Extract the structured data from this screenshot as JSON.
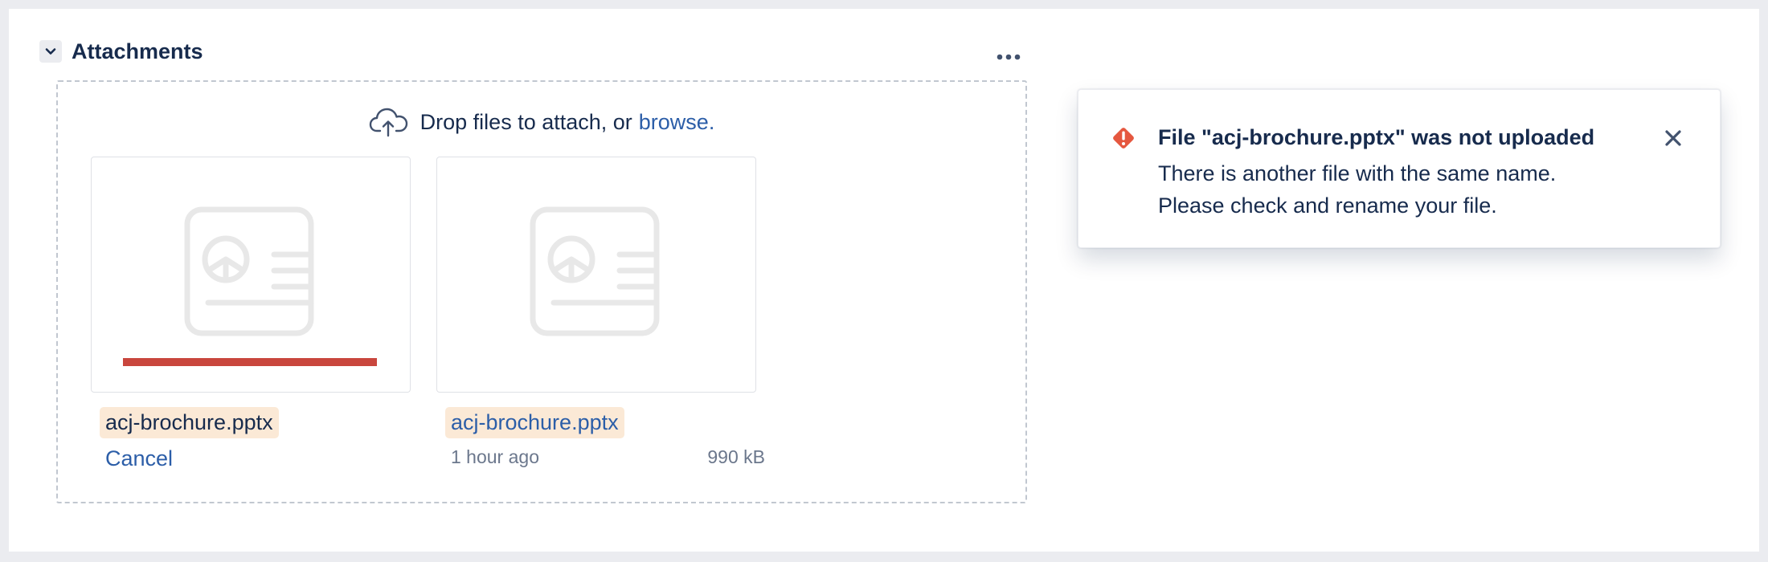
{
  "section": {
    "title": "Attachments",
    "collapse_icon": "chevron-down-icon",
    "more_icon": "more-horizontal-icon"
  },
  "dropzone": {
    "text": "Drop files to attach, or",
    "browse_label": "browse.",
    "icon": "cloud-upload-icon"
  },
  "files": [
    {
      "name": "acj-brochure.pptx",
      "status": "failed",
      "progress": 1.0,
      "progress_color": "#c9463d",
      "cancel_label": "Cancel",
      "icon": "presentation-file-icon"
    },
    {
      "name": "acj-brochure.pptx",
      "status": "uploaded",
      "time": "1 hour ago",
      "size": "990 kB",
      "icon": "presentation-file-icon"
    }
  ],
  "flag": {
    "title": "File \"acj-brochure.pptx\" was not uploaded",
    "body_line1": "There is another file with the same name.",
    "body_line2": "Please check and rename your file.",
    "icon": "error-icon",
    "icon_color": "#e5573f",
    "close_icon": "close-icon"
  },
  "colors": {
    "text": "#172b4d",
    "link": "#2c5ea8",
    "muted": "#6b778c",
    "highlight": "#fbe9d6"
  }
}
